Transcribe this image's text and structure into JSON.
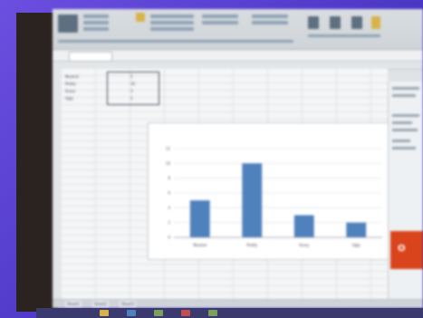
{
  "app": {
    "name": "Microsoft Excel",
    "sheet_tabs": [
      "Sheet1",
      "Sheet2",
      "Sheet3"
    ]
  },
  "cells": [
    {
      "label": "Neutral",
      "value": "5"
    },
    {
      "label": "Pretty",
      "value": "10"
    },
    {
      "label": "Scary",
      "value": "3"
    },
    {
      "label": "Ugly",
      "value": "2"
    }
  ],
  "office_badge": "O",
  "colors": {
    "bar": "#4f81bd",
    "accent": "#d9441c",
    "background": "#5a3fd6"
  },
  "chart_data": {
    "type": "bar",
    "title": "",
    "categories": [
      "Neutral",
      "Pretty",
      "Scary",
      "Ugly"
    ],
    "values": [
      5,
      10,
      3,
      2
    ],
    "data_labels": [
      "",
      "",
      "",
      ""
    ],
    "ylim": [
      0,
      12
    ],
    "yticks": [
      0,
      2,
      4,
      6,
      8,
      10,
      12
    ],
    "grid": true,
    "legend": "none"
  }
}
